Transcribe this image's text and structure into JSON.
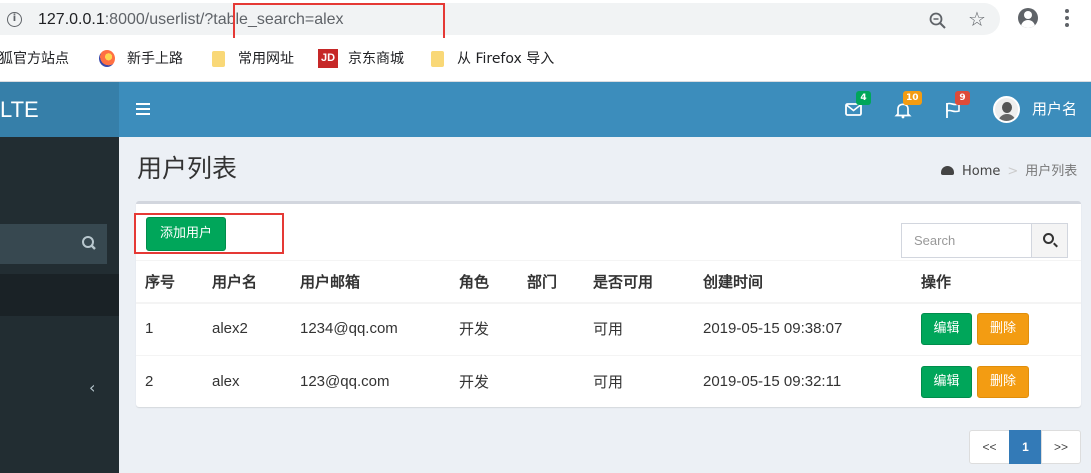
{
  "browser": {
    "url_host": "127.0.0.1",
    "url_rest": ":8000/userlist/?table_search=alex",
    "bookmarks": [
      "火狐官方站点",
      "新手上路",
      "常用网址",
      "京东商城",
      "从 Firefox 导入"
    ],
    "jd_logo": "JD"
  },
  "app": {
    "logo": "LTE",
    "nav": {
      "messages_count": "4",
      "notifications_count": "10",
      "tasks_count": "9",
      "user_name": "用户名",
      "badge_colors": {
        "messages": "#00a65a",
        "notifications": "#f39c12",
        "tasks": "#dd4b39"
      }
    },
    "page_title": "用户列表",
    "breadcrumb": {
      "home": "Home",
      "separator": ">",
      "current": "用户列表"
    },
    "add_button": "添加用户",
    "search_placeholder": "Search",
    "table": {
      "headers": [
        "序号",
        "用户名",
        "用户邮箱",
        "角色",
        "部门",
        "是否可用",
        "创建时间",
        "操作"
      ],
      "rows": [
        {
          "id": "1",
          "username": "alex2",
          "email": "1234@qq.com",
          "role": "开发",
          "dept": "",
          "enabled": "可用",
          "created": "2019-05-15 09:38:07"
        },
        {
          "id": "2",
          "username": "alex",
          "email": "123@qq.com",
          "role": "开发",
          "dept": "",
          "enabled": "可用",
          "created": "2019-05-15 09:32:11"
        }
      ],
      "edit_label": "编辑",
      "delete_label": "删除"
    },
    "pagination": {
      "prev": "<<",
      "page": "1",
      "next": ">>"
    }
  }
}
